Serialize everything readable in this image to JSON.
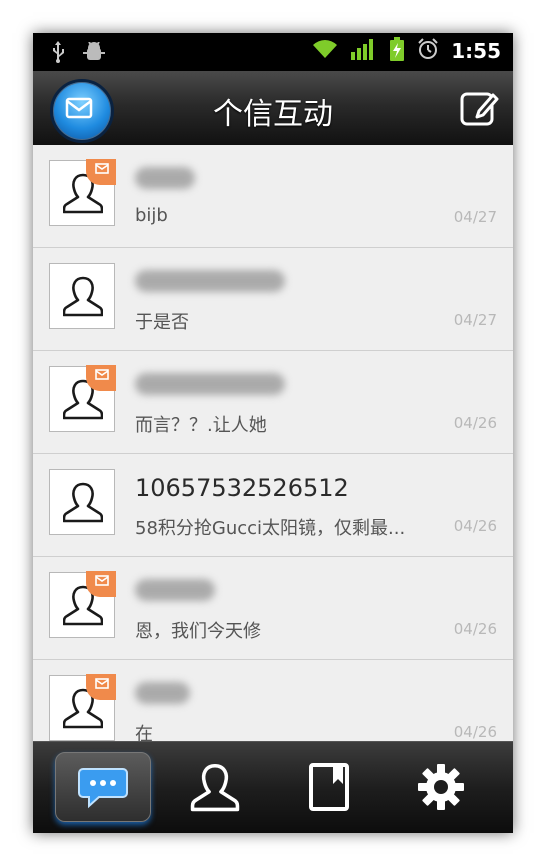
{
  "status_bar": {
    "time": "1:55",
    "icons": [
      "usb-icon",
      "android-debug-icon",
      "wifi-icon",
      "signal-icon",
      "battery-charging-icon",
      "alarm-icon"
    ]
  },
  "header": {
    "title": "个信互动",
    "left_icon": "app-logo-icon",
    "right_icon": "compose-icon"
  },
  "conversations": [
    {
      "name": "",
      "name_blurred": true,
      "preview": "bijb",
      "date": "04/27",
      "unread": true
    },
    {
      "name": "",
      "name_blurred": true,
      "preview": "于是否",
      "date": "04/27",
      "unread": false
    },
    {
      "name": "",
      "name_blurred": true,
      "preview": "而言？？.让人她",
      "date": "04/26",
      "unread": true
    },
    {
      "name": "10657532526512",
      "name_blurred": false,
      "preview": "58积分抢Gucci太阳镜，仅剩最...",
      "date": "04/26",
      "unread": false
    },
    {
      "name": "",
      "name_blurred": true,
      "preview": "恩，我们今天修",
      "date": "04/26",
      "unread": true
    },
    {
      "name": "",
      "name_blurred": true,
      "preview": "在",
      "date": "04/26",
      "unread": true
    }
  ],
  "tabs": [
    {
      "id": "messages",
      "icon": "chat-bubble-icon",
      "active": true
    },
    {
      "id": "contacts",
      "icon": "contact-icon",
      "active": false
    },
    {
      "id": "bookmarks",
      "icon": "bookmark-icon",
      "active": false
    },
    {
      "id": "settings",
      "icon": "gear-icon",
      "active": false
    }
  ],
  "colors": {
    "accent": "#1f8be0",
    "unread_badge": "#f08a4b",
    "date_text": "#b8b8b8"
  }
}
